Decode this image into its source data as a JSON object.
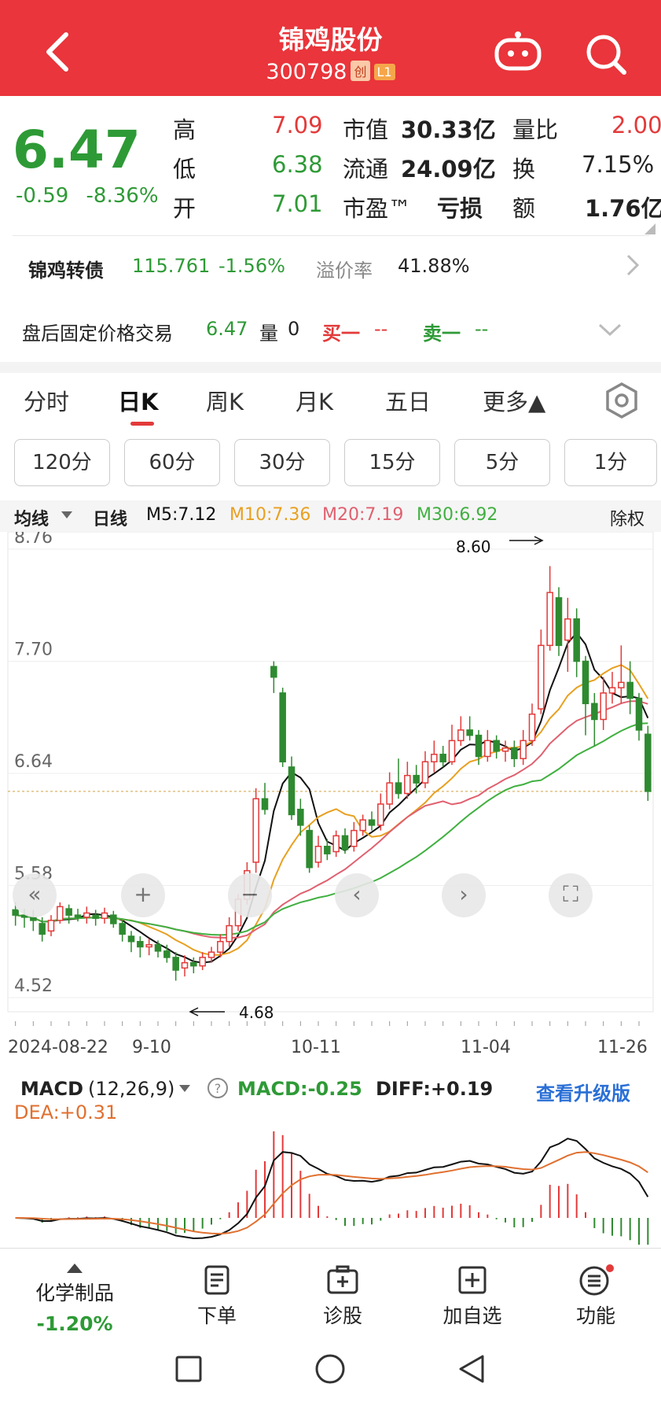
{
  "header": {
    "title": "锦鸡股份",
    "code": "300798",
    "tag1": "创",
    "tag2": "L1"
  },
  "quote": {
    "price": "6.47",
    "change": "-0.59",
    "change_pct": "-8.36%",
    "high_label": "高",
    "high": "7.09",
    "low_label": "低",
    "low": "6.38",
    "open_label": "开",
    "open": "7.01",
    "mcap_label": "市值",
    "mcap": "30.33亿",
    "float_label": "流通",
    "float": "24.09亿",
    "pe_label": "市盈™",
    "pe": "亏损",
    "vr_label": "量比",
    "vr": "2.00",
    "turn_label": "换",
    "turn": "7.15%",
    "amt_label": "额",
    "amt": "1.76亿"
  },
  "bond": {
    "name": "锦鸡转债",
    "price": "115.761",
    "pct": "-1.56%",
    "prem_label": "溢价率",
    "prem": "41.88%"
  },
  "afterhours": {
    "label": "盘后固定价格交易",
    "price": "6.47",
    "vol_label": "量",
    "vol": "0",
    "buy_label": "买一",
    "buy": "--",
    "sell_label": "卖一",
    "sell": "--"
  },
  "tabs": [
    "分时",
    "日K",
    "周K",
    "月K",
    "五日",
    "更多▲"
  ],
  "periods": [
    "120分",
    "60分",
    "30分",
    "15分",
    "5分",
    "1分"
  ],
  "legend": {
    "ma_label": "均线",
    "type": "日线",
    "m5": "M5:7.12",
    "m10": "M10:7.36",
    "m20": "M20:7.19",
    "m30": "M30:6.92",
    "adj": "除权"
  },
  "chart_data": {
    "type": "candlestick",
    "y_ticks": [
      "8.76",
      "7.70",
      "6.64",
      "5.58",
      "4.52"
    ],
    "x_ticks": [
      "2024-08-22",
      "9-10",
      "10-11",
      "11-04",
      "11-26"
    ],
    "ylim": [
      4.52,
      8.76
    ],
    "annotations": [
      {
        "text": "8.60"
      },
      {
        "text": "4.68"
      }
    ],
    "candles": [
      [
        5.35,
        5.3,
        5.42,
        5.2
      ],
      [
        5.3,
        5.28,
        5.36,
        5.18
      ],
      [
        5.28,
        5.25,
        5.35,
        5.15
      ],
      [
        5.22,
        5.12,
        5.28,
        5.05
      ],
      [
        5.15,
        5.25,
        5.3,
        5.1
      ],
      [
        5.25,
        5.38,
        5.42,
        5.22
      ],
      [
        5.36,
        5.3,
        5.4,
        5.22
      ],
      [
        5.3,
        5.28,
        5.36,
        5.24
      ],
      [
        5.28,
        5.32,
        5.38,
        5.22
      ],
      [
        5.3,
        5.27,
        5.35,
        5.2
      ],
      [
        5.27,
        5.32,
        5.37,
        5.22
      ],
      [
        5.3,
        5.22,
        5.34,
        5.18
      ],
      [
        5.22,
        5.12,
        5.25,
        5.05
      ],
      [
        5.1,
        5.05,
        5.15,
        4.95
      ],
      [
        5.05,
        5.0,
        5.1,
        4.9
      ],
      [
        5.0,
        5.02,
        5.08,
        4.92
      ],
      [
        5.02,
        4.96,
        5.06,
        4.9
      ],
      [
        4.96,
        4.9,
        5.02,
        4.85
      ],
      [
        4.9,
        4.78,
        4.95,
        4.68
      ],
      [
        4.8,
        4.85,
        4.92,
        4.72
      ],
      [
        4.85,
        4.82,
        4.9,
        4.75
      ],
      [
        4.82,
        4.9,
        4.95,
        4.78
      ],
      [
        4.9,
        4.95,
        5.0,
        4.85
      ],
      [
        4.95,
        5.05,
        5.12,
        4.9
      ],
      [
        5.05,
        5.2,
        5.28,
        5.0
      ],
      [
        5.2,
        5.45,
        5.5,
        5.15
      ],
      [
        5.45,
        5.72,
        5.8,
        5.4
      ],
      [
        5.8,
        6.4,
        6.5,
        5.7
      ],
      [
        6.4,
        6.3,
        6.55,
        6.25
      ],
      [
        7.65,
        7.55,
        7.7,
        7.4
      ],
      [
        7.4,
        6.75,
        7.45,
        6.7
      ],
      [
        6.7,
        6.25,
        6.8,
        6.2
      ],
      [
        6.3,
        6.15,
        6.4,
        6.05
      ],
      [
        6.1,
        5.75,
        6.15,
        5.7
      ],
      [
        5.8,
        5.95,
        6.05,
        5.75
      ],
      [
        5.95,
        5.88,
        6.02,
        5.82
      ],
      [
        5.9,
        6.05,
        6.1,
        5.85
      ],
      [
        6.05,
        5.92,
        6.12,
        5.88
      ],
      [
        5.95,
        6.1,
        6.18,
        5.9
      ],
      [
        6.1,
        6.2,
        6.25,
        6.05
      ],
      [
        6.2,
        6.15,
        6.28,
        6.1
      ],
      [
        6.15,
        6.35,
        6.45,
        6.1
      ],
      [
        6.35,
        6.55,
        6.65,
        6.3
      ],
      [
        6.55,
        6.45,
        6.78,
        6.4
      ],
      [
        6.45,
        6.62,
        6.75,
        6.4
      ],
      [
        6.62,
        6.55,
        6.72,
        6.45
      ],
      [
        6.55,
        6.75,
        6.85,
        6.5
      ],
      [
        6.75,
        6.82,
        6.95,
        6.65
      ],
      [
        6.82,
        6.75,
        6.9,
        6.7
      ],
      [
        6.75,
        6.95,
        7.1,
        6.72
      ],
      [
        6.95,
        7.05,
        7.18,
        6.9
      ],
      [
        7.05,
        7.0,
        7.18,
        6.95
      ],
      [
        7.0,
        6.8,
        7.05,
        6.72
      ],
      [
        6.8,
        6.95,
        7.05,
        6.75
      ],
      [
        6.95,
        6.85,
        7.0,
        6.78
      ],
      [
        6.85,
        6.88,
        6.95,
        6.75
      ],
      [
        6.88,
        6.78,
        6.95,
        6.7
      ],
      [
        6.78,
        6.95,
        7.05,
        6.72
      ],
      [
        6.95,
        7.2,
        7.3,
        6.9
      ],
      [
        7.25,
        7.85,
        8.0,
        7.2
      ],
      [
        7.85,
        8.35,
        8.6,
        7.8
      ],
      [
        8.3,
        7.85,
        8.4,
        7.75
      ],
      [
        7.9,
        8.1,
        8.3,
        7.6
      ],
      [
        8.1,
        7.7,
        8.2,
        7.55
      ],
      [
        7.7,
        7.3,
        7.75,
        7.0
      ],
      [
        7.3,
        7.15,
        7.4,
        6.9
      ],
      [
        7.15,
        7.4,
        7.55,
        7.05
      ],
      [
        7.4,
        7.45,
        7.6,
        7.3
      ],
      [
        7.45,
        7.5,
        7.85,
        7.3
      ],
      [
        7.5,
        7.35,
        7.7,
        7.2
      ],
      [
        7.35,
        7.05,
        7.4,
        6.95
      ],
      [
        7.01,
        6.47,
        7.09,
        6.38
      ]
    ]
  },
  "macd": {
    "label": "MACD",
    "params": "(12,26,9)",
    "macd": "MACD:-0.25",
    "diff": "DIFF:+0.19",
    "dea": "DEA:+0.31",
    "upgrade": "查看升级版"
  },
  "bottom": {
    "sector": "化学制品",
    "sector_pct": "-1.20%",
    "order": "下单",
    "diag": "诊股",
    "add": "加自选",
    "func": "功能"
  },
  "colors": {
    "up": "#e33a3a",
    "down": "#2e8a30",
    "m5": "#111111",
    "m10": "#e8a020",
    "m20": "#e06070",
    "m30": "#40b040"
  }
}
